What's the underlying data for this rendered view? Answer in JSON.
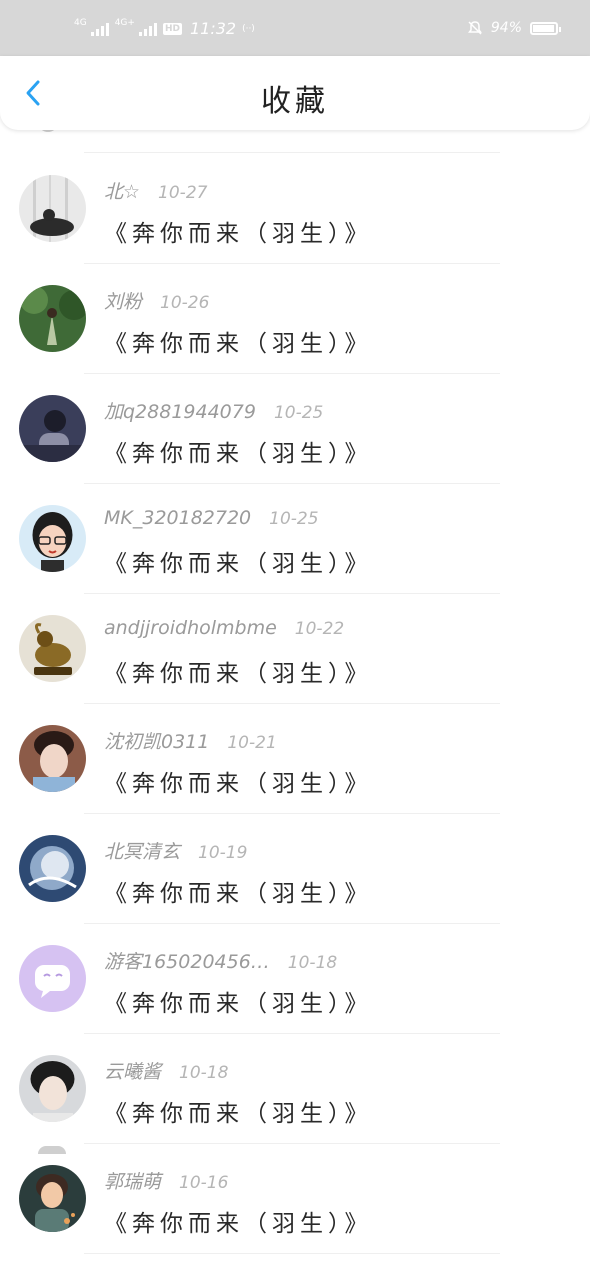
{
  "status_bar": {
    "network_1": "4G",
    "network_2": "4G+",
    "hd": "HD",
    "time": "11:32",
    "wifi": "(··)",
    "battery": "94%",
    "battery_level": 0.94
  },
  "header": {
    "title": "收藏",
    "back_icon": "chevron-left-icon",
    "accent_color": "#2aa2f2"
  },
  "items": [
    {
      "username": "北☆",
      "date": "10-27",
      "title": "《奔你而来（羽生）》",
      "avatar_colors": [
        "#e9e9e9",
        "#2b2b2b"
      ]
    },
    {
      "username": "刘粉",
      "date": "10-26",
      "title": "《奔你而来（羽生）》",
      "avatar_colors": [
        "#3f6a37",
        "#b9c9a4"
      ]
    },
    {
      "username": "加q2881944079",
      "date": "10-25",
      "title": "《奔你而来（羽生）》",
      "avatar_colors": [
        "#3a3e5a",
        "#8d8fa6"
      ]
    },
    {
      "username": "MK_320182720",
      "date": "10-25",
      "title": "《奔你而来（羽生）》",
      "avatar_colors": [
        "#d8ebf7",
        "#1d1d1d"
      ]
    },
    {
      "username": "andjjroidholmbme",
      "date": "10-22",
      "title": "《奔你而来（羽生）》",
      "avatar_colors": [
        "#e6e1d5",
        "#8a6a26"
      ]
    },
    {
      "username": "沈初凯0311",
      "date": "10-21",
      "title": "《奔你而来（羽生）》",
      "avatar_colors": [
        "#8c5b48",
        "#f0d6c8"
      ]
    },
    {
      "username": "北冥清玄",
      "date": "10-19",
      "title": "《奔你而来（羽生）》",
      "avatar_colors": [
        "#2e4a73",
        "#dfe7f1"
      ]
    },
    {
      "username": "游客165020456…",
      "date": "10-18",
      "title": "《奔你而来（羽生）》",
      "avatar_colors": [
        "#d6c2f2",
        "#ffffff"
      ]
    },
    {
      "username": "云曦酱",
      "date": "10-18",
      "title": "《奔你而来（羽生）》",
      "avatar_colors": [
        "#d7d9dc",
        "#1c1c1c"
      ]
    },
    {
      "username": "郭瑞萌",
      "date": "10-16",
      "title": "《奔你而来（羽生）》",
      "avatar_colors": [
        "#2b3d3c",
        "#e8a15a"
      ]
    }
  ]
}
